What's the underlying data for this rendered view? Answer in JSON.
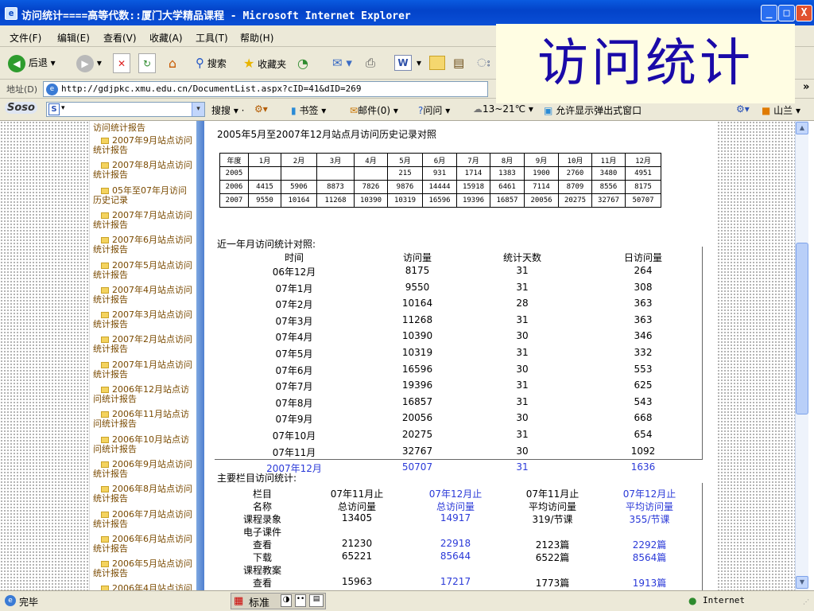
{
  "window": {
    "title": "访问统计====高等代数::厦门大学精品课程 - Microsoft Internet Explorer",
    "controls": {
      "minimize": "_",
      "maximize": "□",
      "close": "X"
    }
  },
  "menu": [
    "文件(F)",
    "编辑(E)",
    "查看(V)",
    "收藏(A)",
    "工具(T)",
    "帮助(H)"
  ],
  "toolbar": {
    "back": "后退",
    "search": "搜索",
    "favorites": "收藏夹"
  },
  "address": {
    "label": "地址(D)",
    "url": "http://gdjpkc.xmu.edu.cn/DocumentList.aspx?cID=41&dID=269",
    "go": "»"
  },
  "soso": {
    "logo": "Soso",
    "box": "S",
    "search": "搜搜",
    "bookmarks": "书签",
    "mail": "邮件(0)",
    "ask": "问问",
    "weather": "13~21℃",
    "popup": "允许显示弹出式窗口",
    "user": "山兰"
  },
  "overlay_title": "访问统计",
  "nav_items": [
    {
      "label": "访问统计报告",
      "folder": false
    },
    {
      "label": "2007年9月站点访问统计报告",
      "folder": true
    },
    {
      "label": "2007年8月站点访问统计报告",
      "folder": true
    },
    {
      "label": "05年至07年月访问历史记录",
      "folder": true
    },
    {
      "label": "2007年7月站点访问统计报告",
      "folder": true
    },
    {
      "label": "2007年6月站点访问统计报告",
      "folder": true
    },
    {
      "label": "2007年5月站点访问统计报告",
      "folder": true
    },
    {
      "label": "2007年4月站点访问统计报告",
      "folder": true
    },
    {
      "label": "2007年3月站点访问统计报告",
      "folder": true
    },
    {
      "label": "2007年2月站点访问统计报告",
      "folder": true
    },
    {
      "label": "2007年1月站点访问统计报告",
      "folder": true
    },
    {
      "label": "2006年12月站点访问统计报告",
      "folder": true
    },
    {
      "label": "2006年11月站点访问统计报告",
      "folder": true
    },
    {
      "label": "2006年10月站点访问统计报告",
      "folder": true
    },
    {
      "label": "2006年9月站点访问统计报告",
      "folder": true
    },
    {
      "label": "2006年8月站点访问统计报告",
      "folder": true
    },
    {
      "label": "2006年7月站点访问统计报告",
      "folder": true
    },
    {
      "label": "2006年6月站点访问统计报告",
      "folder": true
    },
    {
      "label": "2006年5月站点访问统计报告",
      "folder": true
    },
    {
      "label": "2006年4月站点访问",
      "folder": true
    }
  ],
  "history": {
    "heading": "2005年5月至2007年12月站点月访问历史记录对照",
    "header": [
      "年度",
      "1月",
      "2月",
      "3月",
      "4月",
      "5月",
      "6月",
      "7月",
      "8月",
      "9月",
      "10月",
      "11月",
      "12月"
    ],
    "rows": [
      [
        "2005",
        "",
        "",
        "",
        "",
        "215",
        "931",
        "1714",
        "1383",
        "1900",
        "2760",
        "3480",
        "4951"
      ],
      [
        "2006",
        "4415",
        "5906",
        "8873",
        "7826",
        "9876",
        "14444",
        "15918",
        "6461",
        "7114",
        "8709",
        "8556",
        "8175"
      ],
      [
        "2007",
        "9550",
        "10164",
        "11268",
        "10390",
        "10319",
        "16596",
        "19396",
        "16857",
        "20056",
        "20275",
        "32767",
        "50707"
      ]
    ]
  },
  "recent": {
    "heading": "近一年月访问统计对照:",
    "columns": [
      "时间",
      "访问量",
      "统计天数",
      "日访问量"
    ],
    "rows": [
      [
        "06年12月",
        "8175",
        "31",
        "264"
      ],
      [
        "07年1月",
        "9550",
        "31",
        "308"
      ],
      [
        "07年2月",
        "10164",
        "28",
        "363"
      ],
      [
        "07年3月",
        "11268",
        "31",
        "363"
      ],
      [
        "07年4月",
        "10390",
        "30",
        "346"
      ],
      [
        "07年5月",
        "10319",
        "31",
        "332"
      ],
      [
        "07年6月",
        "16596",
        "30",
        "553"
      ],
      [
        "07年7月",
        "19396",
        "31",
        "625"
      ],
      [
        "07年8月",
        "16857",
        "31",
        "543"
      ],
      [
        "07年9月",
        "20056",
        "30",
        "668"
      ],
      [
        "07年10月",
        "20275",
        "31",
        "654"
      ],
      [
        "07年11月",
        "32767",
        "30",
        "1092"
      ],
      [
        "2007年12月",
        "50707",
        "31",
        "1636"
      ]
    ]
  },
  "columns_stats": {
    "heading": "主要栏目访问统计:",
    "header1": [
      "栏目",
      "07年11月止",
      "07年12月止",
      "07年11月止",
      "07年12月止"
    ],
    "header2": [
      "名称",
      "总访问量",
      "总访问量",
      "平均访问量",
      "平均访问量"
    ],
    "rows": [
      [
        "课程录象",
        "13405",
        "14917",
        "319/节课",
        "355/节课"
      ],
      [
        "电子课件",
        "",
        "",
        "",
        ""
      ],
      [
        "查看",
        "21230",
        "22918",
        "2123篇",
        "2292篇"
      ],
      [
        "下载",
        "65221",
        "85644",
        "6522篇",
        "8564篇"
      ],
      [
        "课程教案",
        "",
        "",
        "",
        ""
      ],
      [
        "查看",
        "15963",
        "17217",
        "1773篇",
        "1913篇"
      ]
    ]
  },
  "status": {
    "text": "完毕",
    "ime": "标准",
    "zone": "Internet"
  }
}
